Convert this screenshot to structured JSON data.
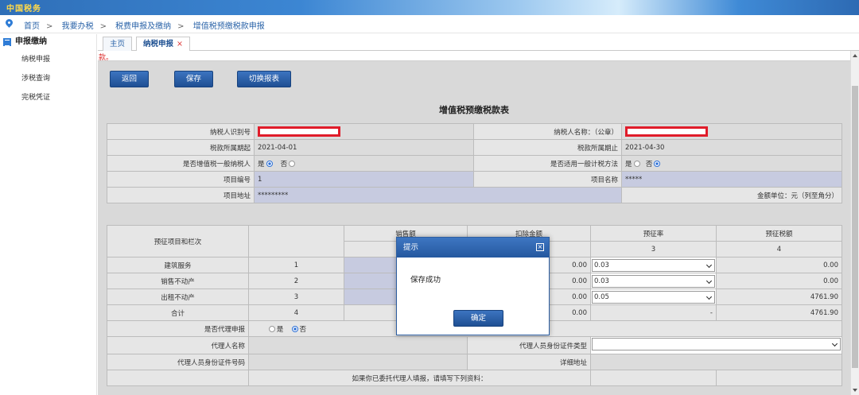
{
  "banner": {
    "logo": "中国税务"
  },
  "breadcrumb": [
    "首页",
    "我要办税",
    "税费申报及缴纳",
    "增值税预缴税款申报"
  ],
  "sidebar": {
    "heading": "申报缴纳",
    "items": [
      "纳税申报",
      "涉税查询",
      "完税凭证"
    ]
  },
  "tabs": {
    "home": "主页",
    "active": "纳税申报",
    "close": "×"
  },
  "note": "款。",
  "toolbar": {
    "back": "返回",
    "save": "保存",
    "switch": "切换报表"
  },
  "form": {
    "title": "增值税预缴税款表",
    "taxpayer_id_label": "纳税人识别号",
    "taxpayer_name_label": "纳税人名称：（公章）",
    "period_start_label": "税款所属期起",
    "period_start": "2021-04-01",
    "period_end_label": "税款所属期止",
    "period_end": "2021-04-30",
    "general_taxpayer_label": "是否增值税一般纳税人",
    "simple_method_label": "是否适用一般计税方法",
    "yes": "是",
    "no": "否",
    "project_no_label": "项目编号",
    "project_no": "1",
    "project_name_label": "项目名称",
    "project_name": "*****",
    "project_addr_label": "项目地址",
    "project_addr": "*********",
    "amount_unit": "金额单位：元（列至角分）"
  },
  "grid": {
    "h_item": "预征项目和栏次",
    "h_sales_partial": "销售额",
    "h_deduct_partial": "扣除金额",
    "h_rate": "预征率",
    "h_tax": "预征税额",
    "h_col3": "3",
    "h_col4": "4",
    "rows": [
      {
        "name": "建筑服务",
        "no": "1",
        "deduct": "0.00",
        "rate": "0.03",
        "tax": "0.00"
      },
      {
        "name": "销售不动产",
        "no": "2",
        "deduct": "0.00",
        "rate": "0.03",
        "tax": "0.00"
      },
      {
        "name": "出租不动产",
        "no": "3",
        "deduct": "0.00",
        "rate": "0.05",
        "tax": "4761.90"
      }
    ],
    "total": {
      "name": "合计",
      "no": "4",
      "deduct": "0.00",
      "rate": "-",
      "tax": "4761.90"
    },
    "agent_label": "是否代理申报",
    "agent_name_label": "代理人名称",
    "agent_id_type_label": "代理人员身份证件类型",
    "agent_id_no_label": "代理人员身份证件号码",
    "address_label": "详细地址",
    "footer_partial": "如果你已委托代理人填报，请填写下列资料："
  },
  "dialog": {
    "title": "提示",
    "close": "×",
    "message": "保存成功",
    "ok": "确定"
  }
}
